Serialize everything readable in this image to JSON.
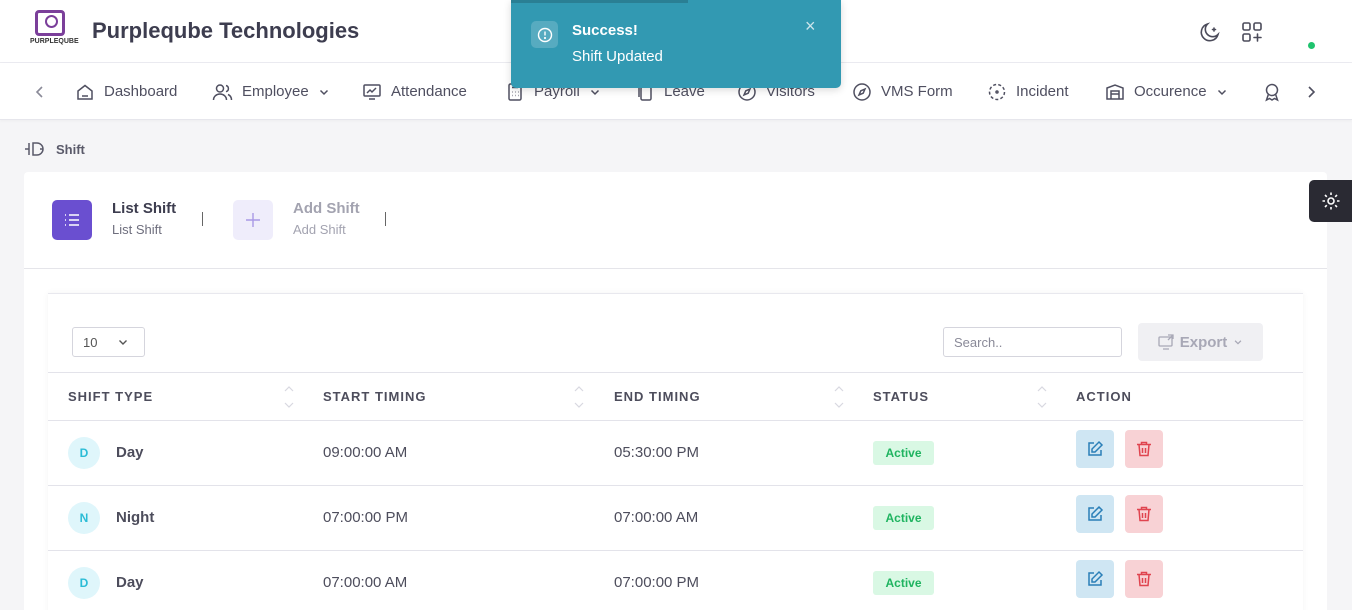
{
  "header": {
    "logo_text": "PURPLEQUBE",
    "brand": "Purpleqube Technologies",
    "icons": [
      "moon-icon",
      "apps-add-icon"
    ],
    "status_color": "#1fc36e"
  },
  "nav": {
    "items": [
      {
        "label": "Dashboard",
        "icon": "home-icon"
      },
      {
        "label": "Employee",
        "icon": "users-icon",
        "dropdown": true
      },
      {
        "label": "Attendance",
        "icon": "monitor-chart-icon"
      },
      {
        "label": "Payroll",
        "icon": "calculator-icon",
        "dropdown": true
      },
      {
        "label": "Leave",
        "icon": "copy-icon"
      },
      {
        "label": "Visitors",
        "icon": "compass-icon"
      },
      {
        "label": "VMS Form",
        "icon": "compass-icon"
      },
      {
        "label": "Incident",
        "icon": "focus-icon"
      },
      {
        "label": "Occurence",
        "icon": "building-icon",
        "dropdown": true
      }
    ]
  },
  "breadcrumb": {
    "label": "Shift"
  },
  "tabs": [
    {
      "title": "List Shift",
      "subtitle": "List Shift",
      "active": true
    },
    {
      "title": "Add Shift",
      "subtitle": "Add Shift",
      "active": false
    }
  ],
  "table_controls": {
    "page_size": "10",
    "search_placeholder": "Search..",
    "export_label": "Export"
  },
  "table": {
    "columns": [
      "SHIFT TYPE",
      "START TIMING",
      "END TIMING",
      "STATUS",
      "ACTION"
    ],
    "rows": [
      {
        "initial": "D",
        "shift_type": "Day",
        "start": "09:00:00 AM",
        "end": "05:30:00 PM",
        "status": "Active"
      },
      {
        "initial": "N",
        "shift_type": "Night",
        "start": "07:00:00 PM",
        "end": "07:00:00 AM",
        "status": "Active"
      },
      {
        "initial": "D",
        "shift_type": "Day",
        "start": "07:00:00 AM",
        "end": "07:00:00 PM",
        "status": "Active"
      }
    ]
  },
  "toast": {
    "title": "Success!",
    "message": "Shift Updated",
    "close": "×",
    "color": "#3299b2"
  },
  "colors": {
    "accent": "#6a4fd0",
    "active_badge": "#1fb460",
    "delete": "#e0444f",
    "edit": "#2a7fb8"
  }
}
